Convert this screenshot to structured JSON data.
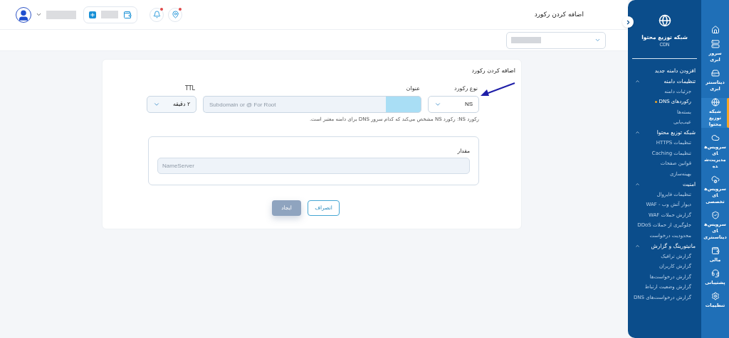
{
  "header": {
    "title": "اضافه کردن رکورد",
    "notifications": {
      "alert": true
    },
    "location": {
      "alert": true
    }
  },
  "form": {
    "title": "اضافه کردن رکورد",
    "fields": [
      {
        "kind": "select",
        "label": "نوع رکورد",
        "value": "NS"
      },
      {
        "kind": "text",
        "label": "عنوان",
        "placeholder": "Subdomain or @ For Root"
      },
      {
        "kind": "select",
        "label": "TTL",
        "value": "۲ دقیقه"
      }
    ],
    "help": "رکورد NS: رکورد NS مشخص می‌کند که کدام سرور DNS برای دامنه معتبر است.",
    "value_field": {
      "label": "مقدار",
      "placeholder": "NameServer"
    },
    "buttons": [
      {
        "kind": "outline",
        "label": "انصراف",
        "disabled": false
      },
      {
        "kind": "primary",
        "label": "ایجاد",
        "disabled": true
      }
    ]
  },
  "sidebar": {
    "title": "شبکه توزیع محتوا",
    "subtitle": "CDN",
    "items": [
      {
        "kind": "link",
        "label": "افزودن دامنه جدید"
      },
      {
        "kind": "group",
        "label": "تنظیمات دامنه",
        "expanded": true,
        "children": [
          {
            "label": "جزئیات دامنه",
            "selected": false
          },
          {
            "label": "رکوردهای DNS",
            "selected": true
          },
          {
            "label": "بسته‌ها",
            "selected": false
          },
          {
            "label": "عیب‌یابی",
            "selected": false
          }
        ]
      },
      {
        "kind": "group",
        "label": "شبکه توزیع محتوا",
        "expanded": true,
        "children": [
          {
            "label": "تنظیمات HTTPS",
            "selected": false
          },
          {
            "label": "تنظیمات Caching",
            "selected": false
          },
          {
            "label": "قوانین صفحات",
            "selected": false
          },
          {
            "label": "بهینه‌سازی",
            "selected": false
          }
        ]
      },
      {
        "kind": "group",
        "label": "امنیت",
        "expanded": true,
        "children": [
          {
            "label": "تنظیمات فایروال",
            "selected": false
          },
          {
            "label": "دیوار آتش وب - WAF",
            "selected": false
          },
          {
            "label": "گزارش حملات WAF",
            "selected": false
          },
          {
            "label": "جلوگیری از حملات DDoS",
            "selected": false
          },
          {
            "label": "محدودیت درخواست",
            "selected": false
          }
        ]
      },
      {
        "kind": "group",
        "label": "مانیتورینگ و گزارش",
        "expanded": true,
        "children": [
          {
            "label": "گزارش ترافیک",
            "selected": false
          },
          {
            "label": "گزارش کاربران",
            "selected": false
          },
          {
            "label": "گزارش درخواست‌ها",
            "selected": false
          },
          {
            "label": "گزارش وضعیت ارتباط",
            "selected": false
          },
          {
            "label": "گزارش درخواست‌های DNS",
            "selected": false
          }
        ]
      }
    ]
  },
  "rail": [
    {
      "kind": "home",
      "selected": false
    },
    {
      "kind": "server",
      "label": "سرور ابری",
      "selected": false
    },
    {
      "kind": "datacenter",
      "label": "دیتاسنتر ابری",
      "selected": false
    },
    {
      "kind": "cdn",
      "label": "شبکه توزیع محتوا",
      "selected": true
    },
    {
      "kind": "managed",
      "label": "سرویس‌های مدیریت‌شده",
      "selected": false
    },
    {
      "kind": "special",
      "label": "سرویس‌های تخصصی",
      "selected": false
    },
    {
      "kind": "dcservices",
      "label": "سرویس‌های دیتاسنتری",
      "selected": false
    },
    {
      "kind": "finance",
      "label": "مالی",
      "selected": false
    },
    {
      "kind": "support",
      "label": "پشتیبانی",
      "selected": false
    },
    {
      "kind": "settings",
      "label": "تنظیمات",
      "selected": false
    }
  ]
}
